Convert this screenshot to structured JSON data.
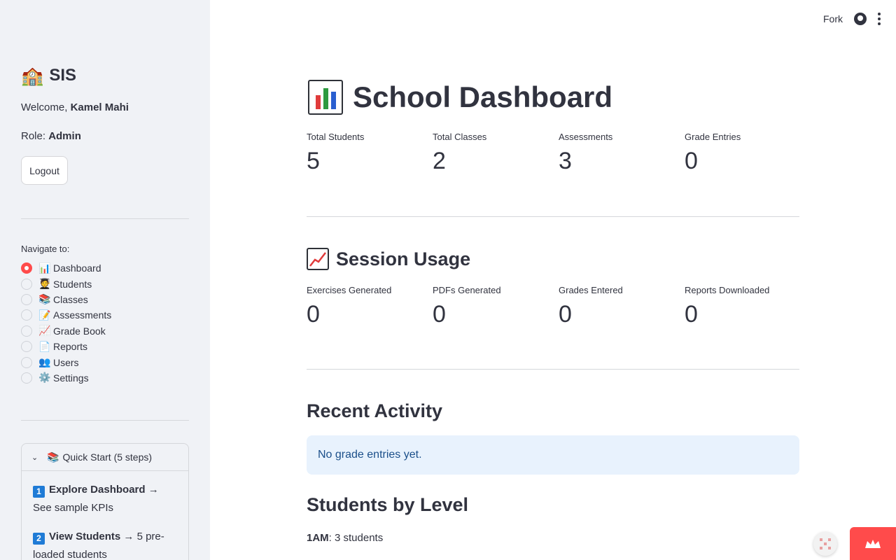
{
  "sidebar": {
    "app_icon": "school-emoji",
    "app_title": "SIS",
    "welcome_prefix": "Welcome, ",
    "user_name": "Kamel Mahi",
    "role_prefix": "Role: ",
    "role": "Admin",
    "logout_label": "Logout",
    "nav_label": "Navigate to:",
    "nav_items": [
      {
        "icon": "📊",
        "label": "Dashboard",
        "selected": true
      },
      {
        "icon": "🧑‍🎓",
        "label": "Students",
        "selected": false
      },
      {
        "icon": "📚",
        "label": "Classes",
        "selected": false
      },
      {
        "icon": "📝",
        "label": "Assessments",
        "selected": false
      },
      {
        "icon": "📈",
        "label": "Grade Book",
        "selected": false
      },
      {
        "icon": "📄",
        "label": "Reports",
        "selected": false
      },
      {
        "icon": "👥",
        "label": "Users",
        "selected": false
      },
      {
        "icon": "⚙️",
        "label": "Settings",
        "selected": false
      }
    ],
    "quick_start": {
      "label": "Quick Start (5 steps)",
      "steps": [
        {
          "num": "1",
          "title": "Explore Dashboard",
          "desc": " → See sample KPIs"
        },
        {
          "num": "2",
          "title": "View Students",
          "desc": " → 5 pre-loaded students"
        }
      ]
    }
  },
  "header": {
    "fork_label": "Fork"
  },
  "main": {
    "title": "School Dashboard",
    "kpis": [
      {
        "label": "Total Students",
        "value": "5"
      },
      {
        "label": "Total Classes",
        "value": "2"
      },
      {
        "label": "Assessments",
        "value": "3"
      },
      {
        "label": "Grade Entries",
        "value": "0"
      }
    ],
    "session_title": "Session Usage",
    "session": [
      {
        "label": "Exercises Generated",
        "value": "0"
      },
      {
        "label": "PDFs Generated",
        "value": "0"
      },
      {
        "label": "Grades Entered",
        "value": "0"
      },
      {
        "label": "Reports Downloaded",
        "value": "0"
      }
    ],
    "recent_title": "Recent Activity",
    "recent_info": "No grade entries yet.",
    "levels_title": "Students by Level",
    "level_name": "1AM",
    "level_text": ": 3 students"
  },
  "colors": {
    "accent": "#ff4b4b",
    "sidebar_bg": "#f0f2f6",
    "info_bg": "#e8f2fd",
    "info_text": "#1b4f8a"
  }
}
